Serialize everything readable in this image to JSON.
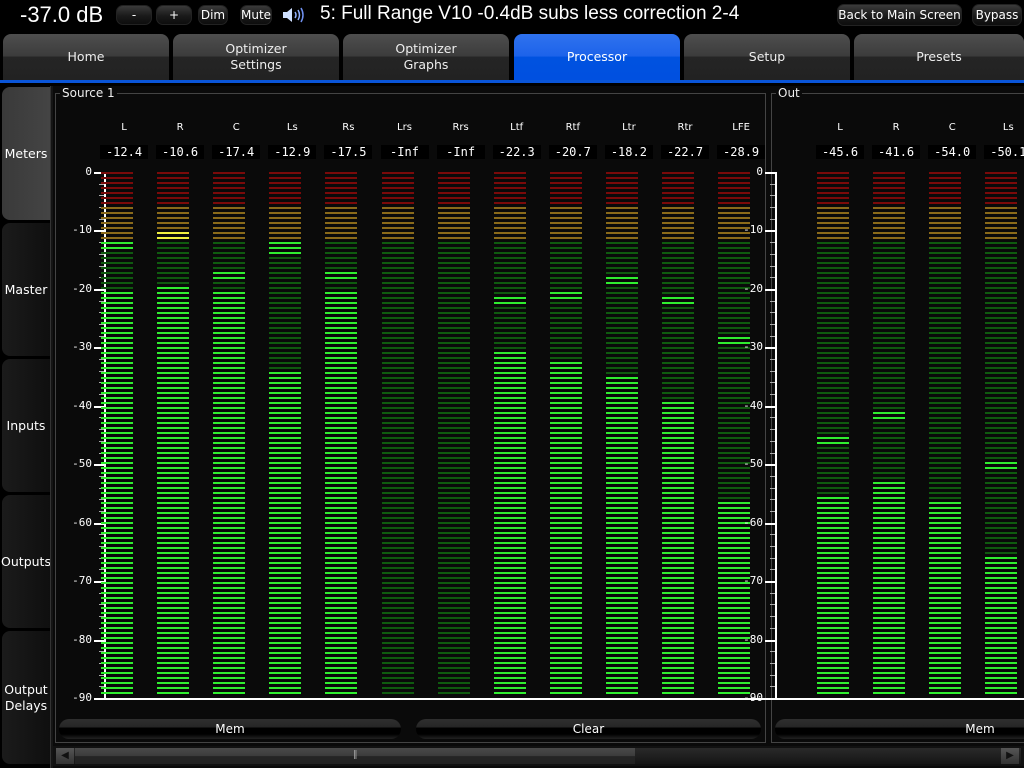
{
  "topbar": {
    "volume": "-37.0 dB",
    "minus_label": "-",
    "plus_label": "+",
    "dim_label": "Dim",
    "mute_label": "Mute",
    "speaker_icon": "speaker-volume-icon",
    "preset_title": "5: Full Range V10 -0.4dB subs less correction 2-4",
    "back_label": "Back to Main Screen",
    "bypass_label": "Bypass"
  },
  "tabs": [
    {
      "label": "Home",
      "active": false
    },
    {
      "label": "Optimizer\nSettings",
      "active": false
    },
    {
      "label": "Optimizer\nGraphs",
      "active": false
    },
    {
      "label": "Processor",
      "active": true
    },
    {
      "label": "Setup",
      "active": false
    },
    {
      "label": "Presets",
      "active": false
    }
  ],
  "side_tabs": [
    {
      "label": "Meters",
      "active": true
    },
    {
      "label": "Master",
      "active": false
    },
    {
      "label": "Inputs",
      "active": false
    },
    {
      "label": "Outputs",
      "active": false
    },
    {
      "label": "Output\nDelays",
      "active": false
    }
  ],
  "colors": {
    "accent": "#0052e0",
    "seg_red_dim": "#7a0a0a",
    "seg_amber_dim": "#8a6a1a",
    "seg_green_dim": "#0f5a0f",
    "seg_green_lit": "#30ee30",
    "seg_yellow_lit": "#f0f040"
  },
  "scale": {
    "max_db": 0,
    "min_db": -90,
    "labels": [
      "0",
      "-10",
      "-20",
      "-30",
      "-40",
      "-50",
      "-60",
      "-70",
      "-80",
      "-90"
    ]
  },
  "source": {
    "title": "Source 1",
    "channels": [
      {
        "name": "L",
        "value": "-12.4",
        "level_db": -20.5,
        "peak_db": -12.4
      },
      {
        "name": "R",
        "value": "-10.6",
        "level_db": -19.0,
        "peak_db": -10.6
      },
      {
        "name": "C",
        "value": "-17.4",
        "level_db": -20.5,
        "peak_db": -17.4
      },
      {
        "name": "Ls",
        "value": "-12.9",
        "level_db": -34.0,
        "peak_db": -12.9
      },
      {
        "name": "Rs",
        "value": "-17.5",
        "level_db": -20.5,
        "peak_db": -17.5
      },
      {
        "name": "Lrs",
        "value": "-Inf",
        "level_db": null,
        "peak_db": null
      },
      {
        "name": "Rrs",
        "value": "-Inf",
        "level_db": null,
        "peak_db": null
      },
      {
        "name": "Ltf",
        "value": "-22.3",
        "level_db": -30.0,
        "peak_db": -21.7
      },
      {
        "name": "Rtf",
        "value": "-20.7",
        "level_db": -32.5,
        "peak_db": -20.7
      },
      {
        "name": "Ltr",
        "value": "-18.2",
        "level_db": -35.0,
        "peak_db": -18.2
      },
      {
        "name": "Rtr",
        "value": "-22.7",
        "level_db": -39.0,
        "peak_db": -22.0
      },
      {
        "name": "LFE",
        "value": "-28.9",
        "level_db": -56.0,
        "peak_db": -28.5
      }
    ],
    "mem_label": "Mem",
    "clear_label": "Clear"
  },
  "out": {
    "title": "Out",
    "channels": [
      {
        "name": "L",
        "value": "-45.6",
        "level_db": -55.0,
        "peak_db": -45.6
      },
      {
        "name": "R",
        "value": "-41.6",
        "level_db": -53.0,
        "peak_db": -41.6
      },
      {
        "name": "C",
        "value": "-54.0",
        "level_db": -57.0,
        "peak_db": -57.0
      },
      {
        "name": "Ls",
        "value": "-50.1",
        "level_db": -65.5,
        "peak_db": -50.1
      }
    ],
    "mem_label": "Mem"
  },
  "scrollbar": {
    "left_icon": "scroll-left-icon",
    "right_icon": "scroll-right-icon",
    "position_fraction": 0.0,
    "visible_fraction": 0.58
  }
}
